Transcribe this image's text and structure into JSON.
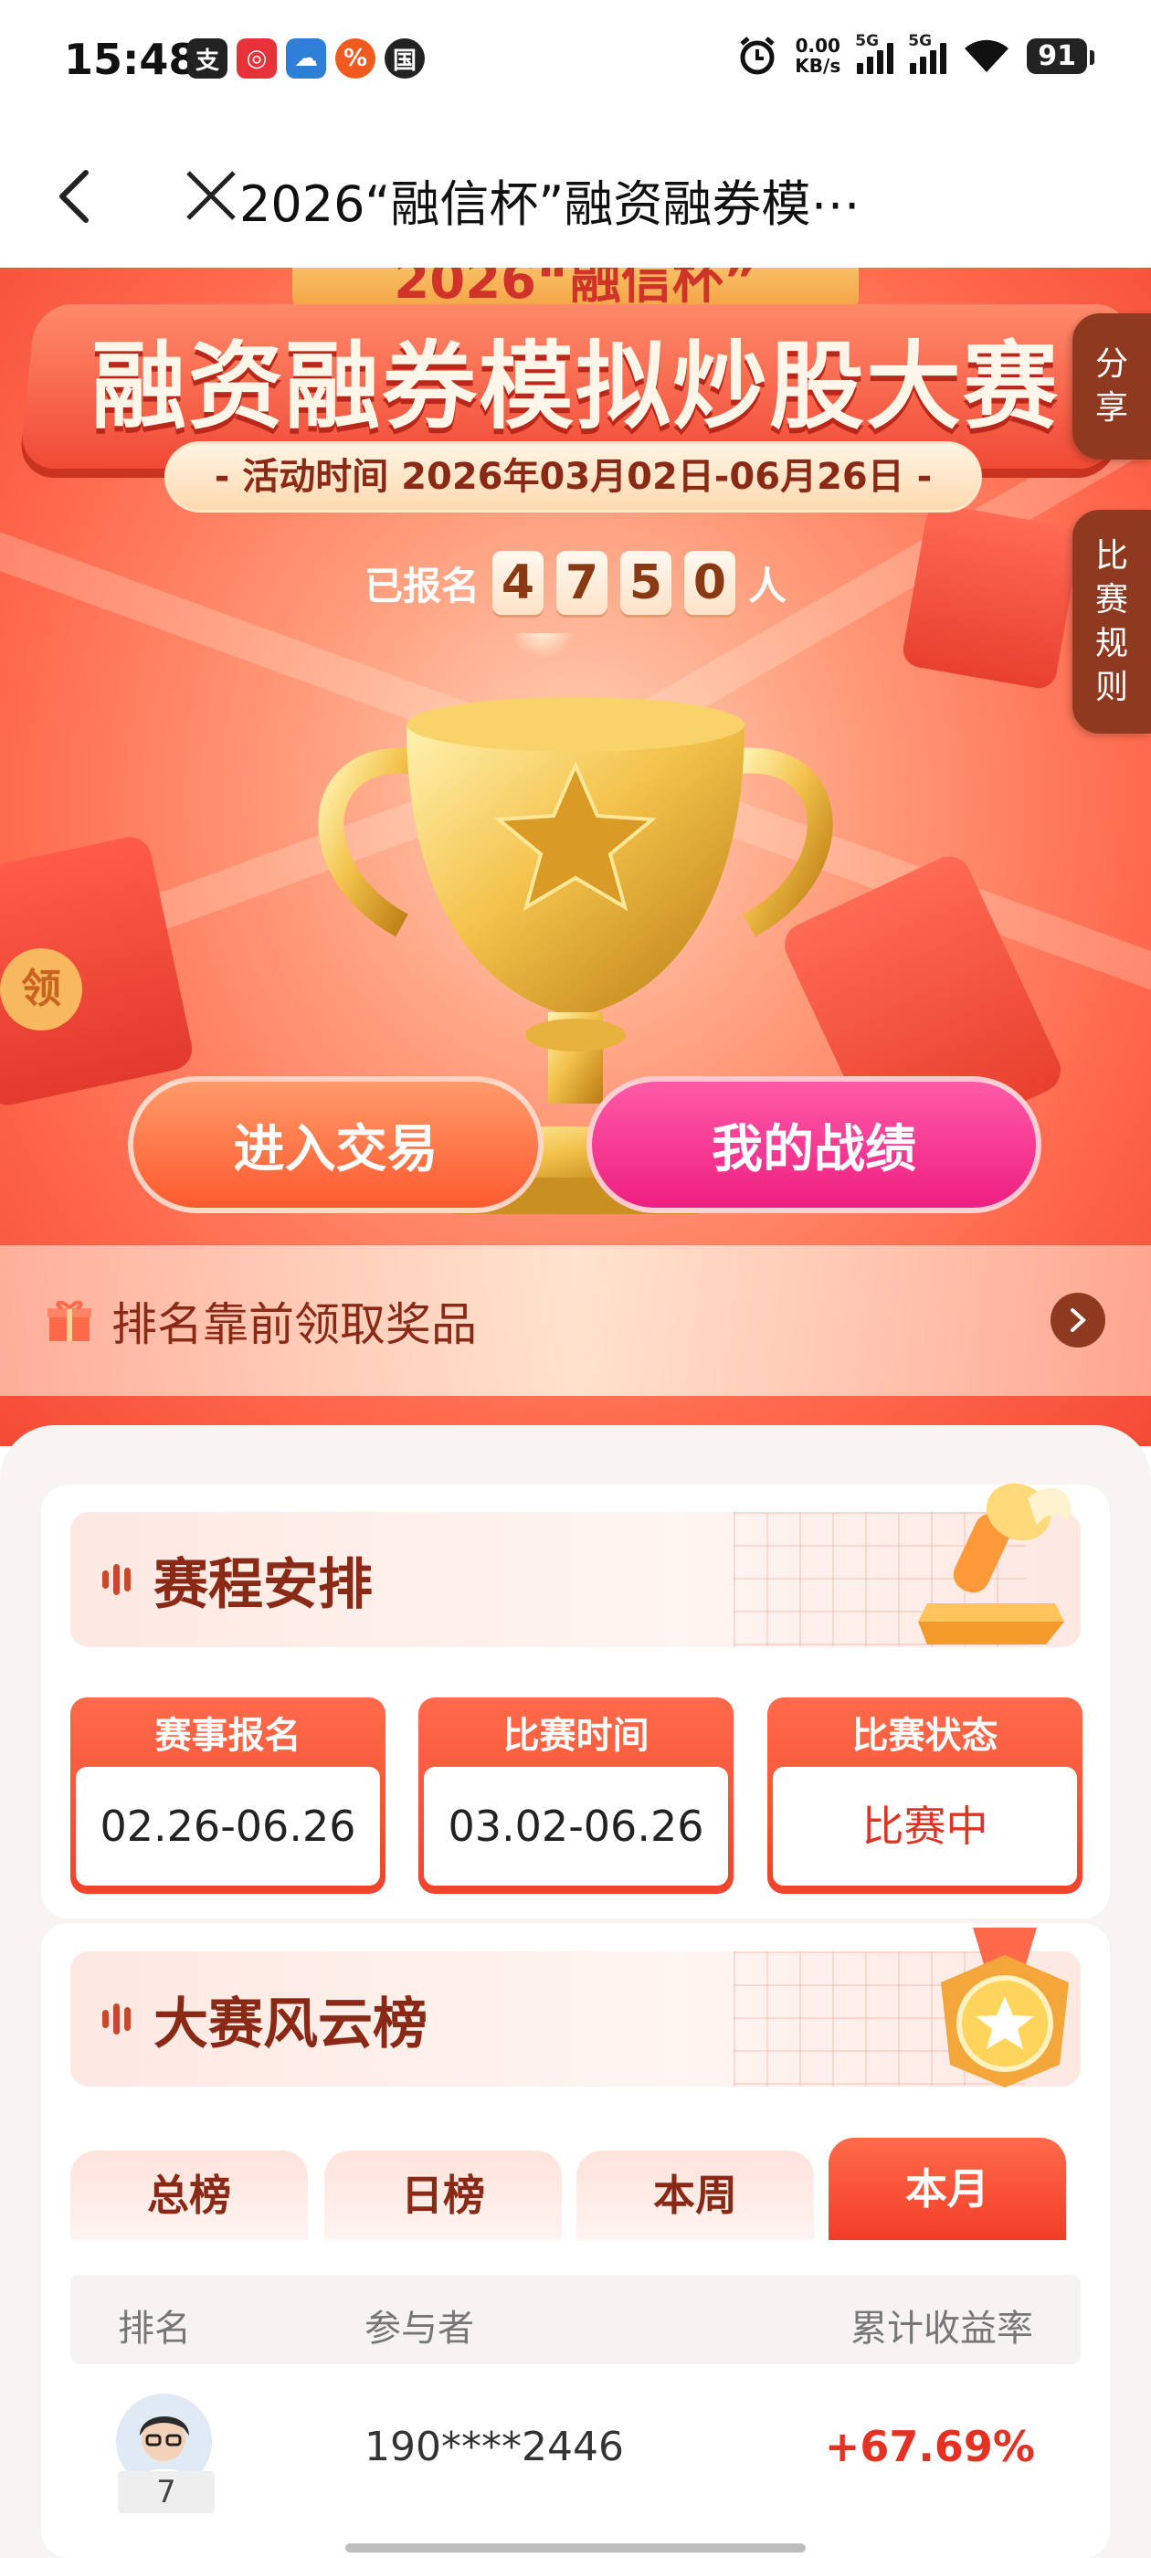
{
  "status_bar": {
    "time": "15:48",
    "net_speed_value": "0.00",
    "net_speed_unit": "KB/s",
    "signal1_tag": "5G",
    "signal2_tag": "5G",
    "battery": "91"
  },
  "nav": {
    "title": "2026“融信杯”融资融券模⋯"
  },
  "hero": {
    "banner_top": "2026“融信杯”",
    "banner_title": "融资融券模拟炒股大赛",
    "date_range": "- 活动时间 2026年03月02日-06月26日 -",
    "registered_prefix": "已报名",
    "registered_digits": [
      "4",
      "7",
      "5",
      "0"
    ],
    "registered_suffix": "人",
    "share_label": [
      "分",
      "享"
    ],
    "rules_label": [
      "比",
      "赛",
      "规",
      "则"
    ],
    "trade_button": "进入交易",
    "record_button": "我的战绩",
    "prize_text": "排名靠前领取奖品"
  },
  "schedule": {
    "title": "赛程安排",
    "items": [
      {
        "label": "赛事报名",
        "value": "02.26-06.26"
      },
      {
        "label": "比赛时间",
        "value": "03.02-06.26"
      },
      {
        "label": "比赛状态",
        "value": "比赛中"
      }
    ]
  },
  "ranking": {
    "title": "大赛风云榜",
    "tabs": [
      "总榜",
      "日榜",
      "本周",
      "本月"
    ],
    "active_tab": "本月",
    "columns": [
      "排名",
      "参与者",
      "累计收益率"
    ],
    "rows": [
      {
        "rank": "7",
        "name": "190****2446",
        "rate": "+67.69%"
      }
    ]
  },
  "colors": {
    "accent": "#f0432c",
    "brand_brown": "#8a2a16",
    "gain_red": "#e33224",
    "pink": "#ee1f80"
  }
}
